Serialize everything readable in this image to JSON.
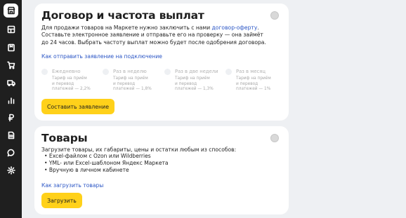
{
  "sidebar": {
    "items": [
      {
        "icon": "store-icon",
        "active": true
      },
      {
        "icon": "dashboard-icon",
        "active": false
      },
      {
        "icon": "book-icon",
        "active": false
      },
      {
        "icon": "cart-icon",
        "active": false
      },
      {
        "icon": "truck-icon",
        "active": false
      },
      {
        "icon": "chart-icon",
        "active": false
      },
      {
        "icon": "ruble-icon",
        "active": false
      },
      {
        "icon": "document-icon",
        "active": false
      },
      {
        "icon": "chat-icon",
        "active": false
      },
      {
        "icon": "settings-icon",
        "active": false
      }
    ]
  },
  "contract": {
    "title": "Договор и частота выплат",
    "desc_line1_pre": "Для продажи товаров на Маркете нужно заключить с нами ",
    "desc_line1_link": "договор-оферту",
    "desc_line1_post": ".",
    "desc_line2": "Составьте электронное заявление и отправьте его на проверку — она займёт",
    "desc_line3": "до 24 часов. Выбрать частоту выплат можно будет после одобрения договора.",
    "help_link": "Как отправить заявление на подключение",
    "frequencies": [
      {
        "label": "Ежедневно",
        "desc": [
          "Тариф на приём",
          "и перевод",
          "платежей — 2,2%"
        ]
      },
      {
        "label": "Раз в неделю",
        "desc": [
          "Тариф на приём",
          "и перевод",
          "платежей — 1,8%"
        ]
      },
      {
        "label": "Раз в две недели",
        "desc": [
          "Тариф на приём",
          "и перевод",
          "платежей — 1,3%"
        ]
      },
      {
        "label": "Раз в месяц",
        "desc": [
          "Тариф на приём",
          "и перевод",
          "платежей — 1%"
        ]
      }
    ],
    "button": "Составить заявление"
  },
  "goods": {
    "title": "Товары",
    "desc": "Загрузите товары, их габариты, цены и остатки любым из способов:",
    "bullets": [
      "• Excel-файлом с Ozon или Wildberries",
      "• YML- или Excel-шаблоном Яндекс Маркета",
      "• Вручную  в личном кабинете"
    ],
    "help_link": "Как загрузить товары",
    "button": "Загрузить"
  }
}
